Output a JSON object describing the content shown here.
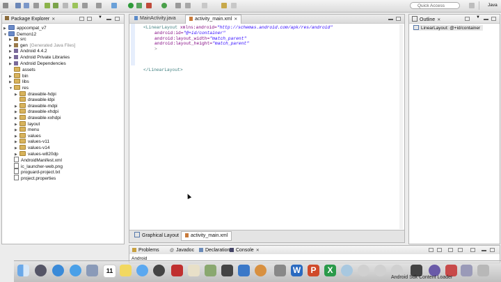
{
  "toolbar": {
    "quick_access_placeholder": "Quick Access",
    "perspective": "Java"
  },
  "package_explorer": {
    "title": "Package Explorer",
    "items": [
      {
        "label": "appcompat_v7",
        "extra": ""
      },
      {
        "label": "Demon12",
        "extra": ""
      },
      {
        "label": "src",
        "extra": ""
      },
      {
        "label": "gen",
        "extra": "[Generated Java Files]"
      },
      {
        "label": "Android 4.4.2",
        "extra": ""
      },
      {
        "label": "Android Private Libraries",
        "extra": ""
      },
      {
        "label": "Android Dependencies",
        "extra": ""
      },
      {
        "label": "assets",
        "extra": ""
      },
      {
        "label": "bin",
        "extra": ""
      },
      {
        "label": "libs",
        "extra": ""
      },
      {
        "label": "res",
        "extra": ""
      },
      {
        "label": "drawable-hdpi",
        "extra": ""
      },
      {
        "label": "drawable-ldpi",
        "extra": ""
      },
      {
        "label": "drawable-mdpi",
        "extra": ""
      },
      {
        "label": "drawable-xhdpi",
        "extra": ""
      },
      {
        "label": "drawable-xxhdpi",
        "extra": ""
      },
      {
        "label": "layout",
        "extra": ""
      },
      {
        "label": "menu",
        "extra": ""
      },
      {
        "label": "values",
        "extra": ""
      },
      {
        "label": "values-v11",
        "extra": ""
      },
      {
        "label": "values-v14",
        "extra": ""
      },
      {
        "label": "values-w820dp",
        "extra": ""
      },
      {
        "label": "AndroidManifest.xml",
        "extra": ""
      },
      {
        "label": "ic_launcher-web.png",
        "extra": ""
      },
      {
        "label": "proguard-project.txt",
        "extra": ""
      },
      {
        "label": "project.properties",
        "extra": ""
      }
    ]
  },
  "editor": {
    "tabs": [
      "MainActivity.java",
      "activity_main.xml"
    ],
    "code": {
      "open_tag": "<LinearLayout",
      "xmlns_attr": "xmlns:android=",
      "xmlns_val": "\"http://schemas.android.com/apk/res/android\"",
      "id_attr": "android:id=",
      "id_val": "\"@+id/container\"",
      "width_attr": "android:layout_width=",
      "width_val": "\"match_parent\"",
      "height_attr": "android:layout_height=",
      "height_val": "\"match_parent\"",
      "close_bracket": ">",
      "end_tag": "</LinearLayout>"
    },
    "bottom_tabs": [
      "Graphical Layout",
      "activity_main.xml"
    ]
  },
  "outline": {
    "title": "Outline",
    "item": "LinearLayout: @+id/container"
  },
  "bottom_panel": {
    "tabs": [
      "Problems",
      "Javadoc",
      "Declaration",
      "Console"
    ],
    "console_text": "Android"
  },
  "dock": {
    "calendar_day": "11",
    "status_text": "Android Sdk Content Loader"
  }
}
